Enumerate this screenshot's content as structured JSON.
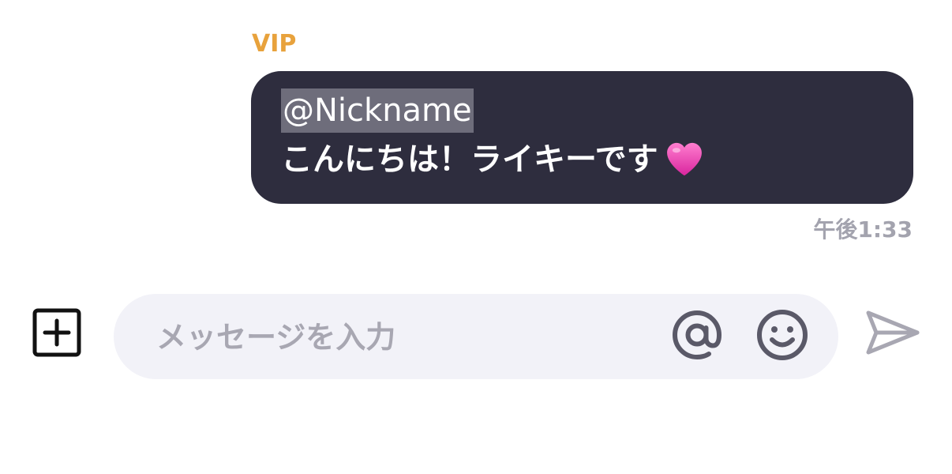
{
  "message": {
    "sender_badge": "VIP",
    "mention": "@Nickname",
    "text": "こんにちは！ライキーです",
    "emoji_icon": "pink-heart-icon",
    "timestamp": "午後1:33"
  },
  "composer": {
    "placeholder": "メッセージを入力",
    "value": "",
    "add_icon": "plus-square-icon",
    "mention_icon": "at-sign-icon",
    "emoji_icon": "smiley-icon",
    "send_icon": "send-arrow-icon"
  },
  "colors": {
    "badge": "#E8A23C",
    "bubble": "#2E2D3E",
    "mention_highlight": "#6E6D7B",
    "input_background": "#F2F2F8",
    "icon_dark": "#5A5968",
    "timestamp": "#A3A3AE"
  }
}
